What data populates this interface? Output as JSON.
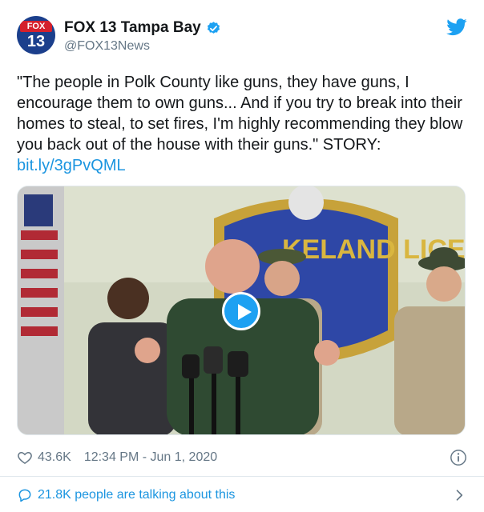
{
  "account": {
    "avatar_brand": "FOX",
    "avatar_number": "13",
    "display_name": "FOX 13 Tampa Bay",
    "handle": "@FOX13News",
    "verified": true
  },
  "tweet": {
    "text": "\"The people in Polk County like guns, they have guns, I encourage them to own guns... And if you try to break into their homes to steal, to set fires, I'm highly recommending they blow you back out of the house with their guns.\" STORY:",
    "link": "bit.ly/3gPvQML"
  },
  "media": {
    "type": "video",
    "badge_text": "KELAND LICE"
  },
  "stats": {
    "likes": "43.6K",
    "timestamp": "12:34 PM - Jun 1, 2020"
  },
  "conversation": {
    "text": "21.8K people are talking about this"
  },
  "icons": {
    "verified": "verified-badge-icon",
    "brand": "twitter-bird-icon",
    "like": "heart-icon",
    "info": "info-icon",
    "reply": "speech-bubble-icon",
    "more": "chevron-right-icon"
  },
  "colors": {
    "accent": "#1da1f2",
    "link": "#1b95e0",
    "muted": "#657786",
    "text": "#14171a"
  }
}
